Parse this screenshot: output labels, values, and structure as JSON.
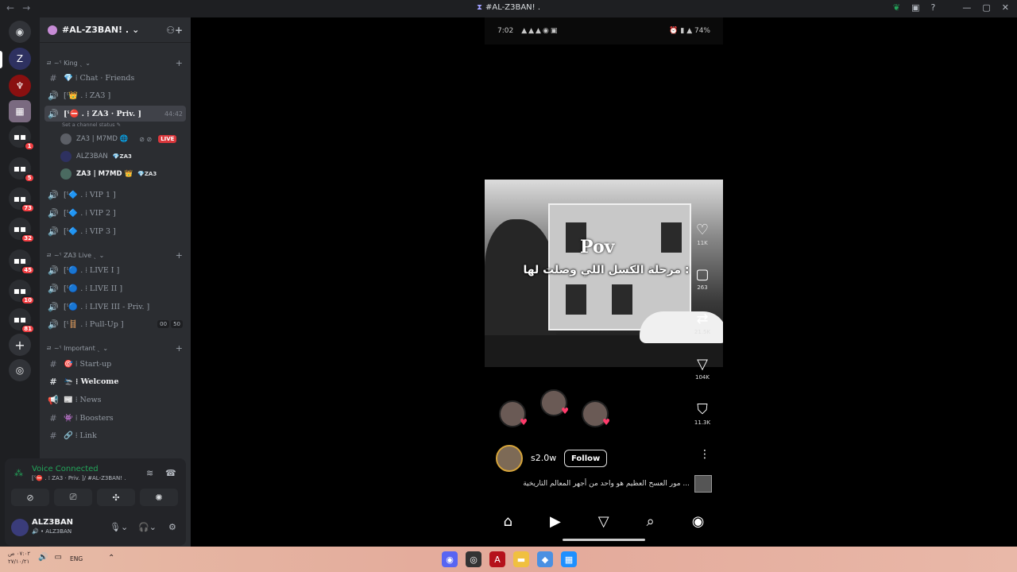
{
  "titlebar": {
    "title": "#AL-Z3BAN! .",
    "hash": "⧗",
    "back": "←",
    "forward": "→"
  },
  "rail": {
    "badges": [
      "1",
      "5",
      "73",
      "32",
      "45",
      "10",
      "81"
    ]
  },
  "guild": {
    "name": "#AL-Z3BAN! .",
    "chevron": "⌄"
  },
  "categories": {
    "king": "ㄹ ~ˁ King ˎ",
    "live": "ㄹ ~ˁ ZA3 Live ˎ",
    "important": "ㄹ ~ˁ Important ˎ"
  },
  "channels": {
    "chat": "💎 ⁞ Chat · Friends",
    "za3": "[ˁ👑 . ⁞ ZA3 ]",
    "priv": "[ˁ⛔ . ⁞ ZA3 · Priv. ]",
    "priv_time": "44:42",
    "priv_status": "Set a channel status ✎",
    "vip1": "[ˁ🔷 . ⁞ VIP 1 ]",
    "vip2": "[ˁ🔷 . ⁞ VIP 2 ]",
    "vip3": "[ˁ🔷 . ⁞ VIP 3 ]",
    "live1": "[ˁ🔵 . ⁞ LIVE I ]",
    "live2": "[ˁ🔵 . ⁞ LIVE II ]",
    "live3": "[ˁ🔵 . ⁞ LIVE III - Priv. ]",
    "pullup": "[ˁ🪜 . ⁞ Pull-Up ]",
    "pullup_count": [
      "00",
      "50"
    ],
    "startup": "🎯 ⁞ Start-up",
    "welcome": "🛬 ⁞ Welcome",
    "news": "📰 ⁞ News",
    "boosters": "👾 ⁞ Boosters",
    "link": "🔗 ⁞ Link"
  },
  "voice_users": [
    {
      "name": "ZA3 | M7MD 🌐",
      "live": "LIVE"
    },
    {
      "name": "ALZ3BAN",
      "tag": "💎ZA3"
    },
    {
      "name": "ZA3 | M7MD 👑",
      "tag": "💎ZA3"
    }
  ],
  "panel": {
    "voice_title": "Voice Connected",
    "voice_sub": "[ˁ⛔ . ⁞ ZA3 · Priv. ]/ #AL-Z3BAN! .",
    "username": "ALZ3BAN",
    "user_status": "🔊 • ALZ3BAN"
  },
  "phone": {
    "time": "7:02",
    "battery": "74%",
    "overlay_title": "Pov",
    "overlay_text": "مرحلة الكسل اللي وصلت لها :",
    "likes": "11K",
    "comments": "263",
    "reposts": "21.5K",
    "shares": "104K",
    "saves": "11.3K",
    "account": "s2.0w",
    "follow": "Follow",
    "caption": "مور العسح العظيم هو واحد من أجهر المعالم التاريخية ..."
  },
  "taskbar": {
    "date1": "٠٧:٠٢ ص",
    "date2": "٢٧/١٠/٢١",
    "lang": "ENG"
  },
  "colors": {
    "accent_green": "#23a55a",
    "live_red": "#da373c",
    "badge_red": "#f23f43"
  }
}
